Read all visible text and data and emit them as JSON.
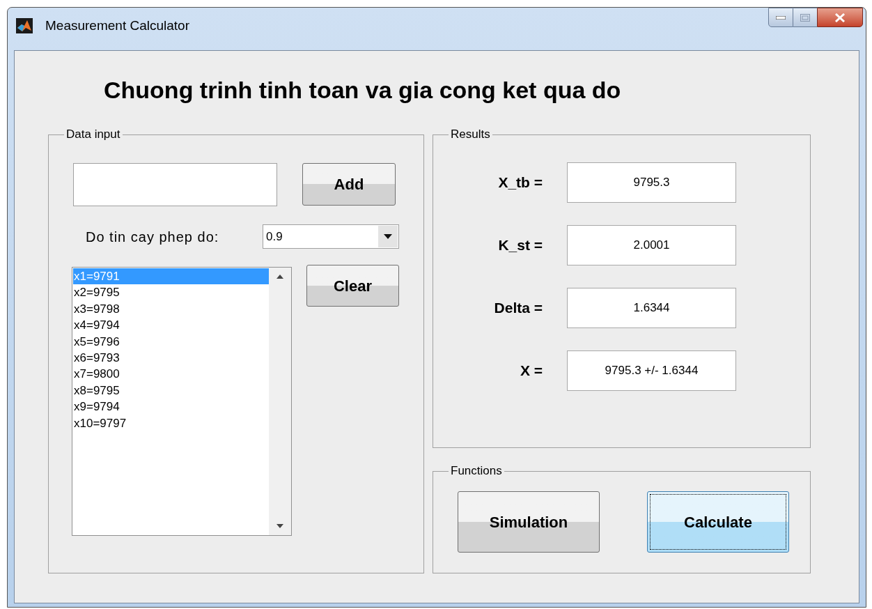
{
  "window": {
    "title": "Measurement Calculator"
  },
  "heading": "Chuong trinh tinh toan va gia cong ket qua do",
  "data_input": {
    "title": "Data input",
    "add_button": "Add",
    "confidence": {
      "label": "Do tin cay phep do:",
      "value": "0.9"
    },
    "list": [
      {
        "label": "x1=9791",
        "selected": true
      },
      {
        "label": "x2=9795",
        "selected": false
      },
      {
        "label": "x3=9798",
        "selected": false
      },
      {
        "label": "x4=9794",
        "selected": false
      },
      {
        "label": "x5=9796",
        "selected": false
      },
      {
        "label": "x6=9793",
        "selected": false
      },
      {
        "label": "x7=9800",
        "selected": false
      },
      {
        "label": "x8=9795",
        "selected": false
      },
      {
        "label": "x9=9794",
        "selected": false
      },
      {
        "label": "x10=9797",
        "selected": false
      }
    ],
    "clear_button": "Clear"
  },
  "results": {
    "title": "Results",
    "rows": [
      {
        "label": "X_tb =",
        "value": "9795.3"
      },
      {
        "label": "K_st =",
        "value": "2.0001"
      },
      {
        "label": "Delta =",
        "value": "1.6344"
      },
      {
        "label": "X =",
        "value": "9795.3 +/- 1.6344"
      }
    ]
  },
  "functions": {
    "title": "Functions",
    "buttons": [
      {
        "label": "Simulation",
        "focused": false
      },
      {
        "label": "Calculate",
        "focused": true
      }
    ]
  }
}
